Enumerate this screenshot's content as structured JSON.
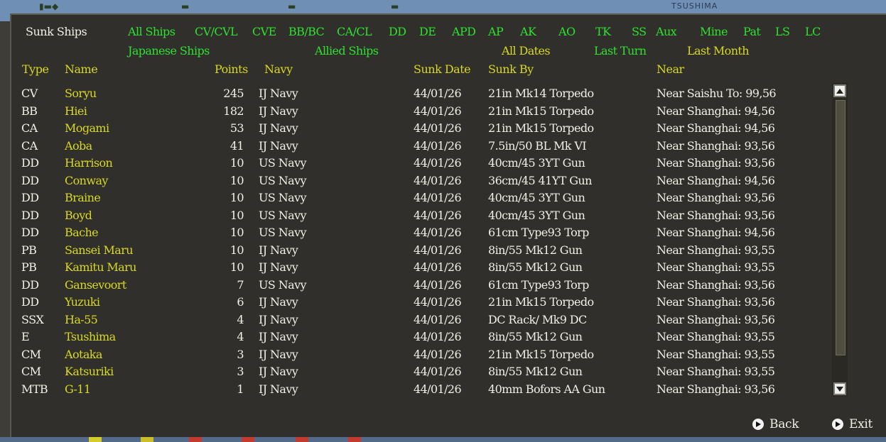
{
  "window": {
    "title": "Sunk Ships",
    "map_label": "TSUSHIMA"
  },
  "filters": {
    "ship_types": [
      {
        "label": "All Ships"
      },
      {
        "label": "CV/CVL"
      },
      {
        "label": "CVE"
      },
      {
        "label": "BB/BC"
      },
      {
        "label": "CA/CL"
      },
      {
        "label": "DD"
      },
      {
        "label": "DE"
      },
      {
        "label": "APD"
      },
      {
        "label": "AP"
      },
      {
        "label": "AK"
      },
      {
        "label": "AO"
      },
      {
        "label": "TK"
      },
      {
        "label": "SS"
      },
      {
        "label": "Aux"
      },
      {
        "label": "Mine"
      },
      {
        "label": "Pat"
      },
      {
        "label": "LS"
      },
      {
        "label": "LC"
      }
    ],
    "sides": {
      "japanese": "Japanese Ships",
      "allied": "Allied Ships"
    },
    "dates": {
      "all": "All Dates",
      "last_turn": "Last Turn",
      "last_month": "Last Month"
    }
  },
  "columns": {
    "type": "Type",
    "name": "Name",
    "points": "Points",
    "navy": "Navy",
    "sunk_date": "Sunk Date",
    "sunk_by": "Sunk By",
    "near": "Near"
  },
  "rows": [
    {
      "type": "CV",
      "name": "Soryu",
      "points": "245",
      "navy": "IJ Navy",
      "date": "44/01/26",
      "by": "21in Mk14 Torpedo",
      "near": "Near Saishu To: 99,56"
    },
    {
      "type": "BB",
      "name": "Hiei",
      "points": "182",
      "navy": "IJ Navy",
      "date": "44/01/26",
      "by": "21in Mk15 Torpedo",
      "near": "Near Shanghai: 94,56"
    },
    {
      "type": "CA",
      "name": "Mogami",
      "points": "53",
      "navy": "IJ Navy",
      "date": "44/01/26",
      "by": "21in Mk15 Torpedo",
      "near": "Near Shanghai: 94,56"
    },
    {
      "type": "CA",
      "name": "Aoba",
      "points": "41",
      "navy": "IJ Navy",
      "date": "44/01/26",
      "by": "7.5in/50 BL Mk VI",
      "near": "Near Shanghai: 93,56"
    },
    {
      "type": "DD",
      "name": "Harrison",
      "points": "10",
      "navy": "US Navy",
      "date": "44/01/26",
      "by": "40cm/45 3YT Gun",
      "near": "Near Shanghai: 93,56"
    },
    {
      "type": "DD",
      "name": "Conway",
      "points": "10",
      "navy": "US Navy",
      "date": "44/01/26",
      "by": "36cm/45 41YT Gun",
      "near": "Near Shanghai: 94,56"
    },
    {
      "type": "DD",
      "name": "Braine",
      "points": "10",
      "navy": "US Navy",
      "date": "44/01/26",
      "by": "40cm/45 3YT Gun",
      "near": "Near Shanghai: 93,56"
    },
    {
      "type": "DD",
      "name": "Boyd",
      "points": "10",
      "navy": "US Navy",
      "date": "44/01/26",
      "by": "40cm/45 3YT Gun",
      "near": "Near Shanghai: 93,56"
    },
    {
      "type": "DD",
      "name": "Bache",
      "points": "10",
      "navy": "US Navy",
      "date": "44/01/26",
      "by": "61cm Type93 Torp",
      "near": "Near Shanghai: 94,56"
    },
    {
      "type": "PB",
      "name": "Sansei Maru",
      "points": "10",
      "navy": "IJ Navy",
      "date": "44/01/26",
      "by": "8in/55 Mk12 Gun",
      "near": "Near Shanghai: 93,55"
    },
    {
      "type": "PB",
      "name": "Kamitu Maru",
      "points": "10",
      "navy": "IJ Navy",
      "date": "44/01/26",
      "by": "8in/55 Mk12 Gun",
      "near": "Near Shanghai: 93,55"
    },
    {
      "type": "DD",
      "name": "Gansevoort",
      "points": "7",
      "navy": "US Navy",
      "date": "44/01/26",
      "by": "61cm Type93 Torp",
      "near": "Near Shanghai: 93,56"
    },
    {
      "type": "DD",
      "name": "Yuzuki",
      "points": "6",
      "navy": "IJ Navy",
      "date": "44/01/26",
      "by": "21in Mk15 Torpedo",
      "near": "Near Shanghai: 93,56"
    },
    {
      "type": "SSX",
      "name": "Ha-55",
      "points": "4",
      "navy": "IJ Navy",
      "date": "44/01/26",
      "by": "DC Rack/ Mk9 DC",
      "near": "Near Shanghai: 93,56"
    },
    {
      "type": "E",
      "name": "Tsushima",
      "points": "4",
      "navy": "IJ Navy",
      "date": "44/01/26",
      "by": "8in/55 Mk12 Gun",
      "near": "Near Shanghai: 93,55"
    },
    {
      "type": "CM",
      "name": "Aotaka",
      "points": "3",
      "navy": "IJ Navy",
      "date": "44/01/26",
      "by": "21in Mk15 Torpedo",
      "near": "Near Shanghai: 93,55"
    },
    {
      "type": "CM",
      "name": "Katsuriki",
      "points": "3",
      "navy": "IJ Navy",
      "date": "44/01/26",
      "by": "8in/55 Mk12 Gun",
      "near": "Near Shanghai: 93,55"
    },
    {
      "type": "MTB",
      "name": "G-11",
      "points": "1",
      "navy": "IJ Navy",
      "date": "44/01/26",
      "by": "40mm Bofors AA Gun",
      "near": "Near Shanghai: 93,56"
    }
  ],
  "buttons": {
    "back": "Back",
    "exit": "Exit"
  },
  "icons": {
    "back": "arrow-right-circle-icon",
    "exit": "arrow-right-circle-icon",
    "scroll_up": "triangle-up-icon",
    "scroll_down": "triangle-down-icon"
  },
  "colors": {
    "background": "#302f2c",
    "active_filter": "#2fe02f",
    "selected_filter": "#d8d822",
    "text": "#f0f0e6"
  }
}
